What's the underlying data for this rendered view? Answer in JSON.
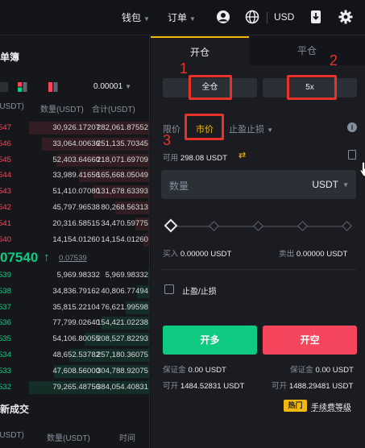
{
  "topnav": {
    "wallet_label": "钱包",
    "orders_label": "订单",
    "currency_label": "USD",
    "icons": [
      "account-icon",
      "globe-icon",
      "download-icon",
      "gear-icon"
    ]
  },
  "orderbook": {
    "title": "单簿",
    "precision": "0.00001",
    "head_price": "(USDT)",
    "head_amount": "数量(USDT)",
    "head_total": "合计(USDT)",
    "asks": [
      {
        "price": "547",
        "amount": "30,926.17207",
        "total": "282,061.87552"
      },
      {
        "price": "546",
        "amount": "33,064.00636",
        "total": "251,135.70345"
      },
      {
        "price": "545",
        "amount": "52,403.64660",
        "total": "218,071.69709"
      },
      {
        "price": "544",
        "amount": "33,989.41656",
        "total": "165,668.05049"
      },
      {
        "price": "543",
        "amount": "51,410.07080",
        "total": "131,678.63393"
      },
      {
        "price": "542",
        "amount": "45,797.96538",
        "total": "80,268.56313"
      },
      {
        "price": "541",
        "amount": "20,316.58515",
        "total": "34,470.59775"
      },
      {
        "price": "540",
        "amount": "14,154.01260",
        "total": "14,154.01260"
      }
    ],
    "mid_price": "07540",
    "mid_arrow": "↑",
    "mark_price": "0.07539",
    "bids": [
      {
        "price": "539",
        "amount": "5,969.98332",
        "total": "5,969.98332"
      },
      {
        "price": "538",
        "amount": "34,836.79162",
        "total": "40,806.77494"
      },
      {
        "price": "537",
        "amount": "35,815.22104",
        "total": "76,621.99598"
      },
      {
        "price": "536",
        "amount": "77,799.02640",
        "total": "154,421.02238"
      },
      {
        "price": "535",
        "amount": "54,106.80055",
        "total": "208,527.82293"
      },
      {
        "price": "534",
        "amount": "48,652.53782",
        "total": "257,180.36075"
      },
      {
        "price": "533",
        "amount": "47,608.56000",
        "total": "304,788.92075"
      },
      {
        "price": "532",
        "amount": "79,265.48756",
        "total": "384,054.40831"
      }
    ],
    "trades_title": "新成交",
    "trades_head_price": "(USDT)",
    "trades_head_amount": "数量(USDT)",
    "trades_head_time": "时间"
  },
  "trade_panel": {
    "tab_open": "开仓",
    "tab_close": "平仓",
    "margin_mode": "全仓",
    "leverage": "5x",
    "order_type_limit": "限价",
    "order_type_market": "市价",
    "order_type_stop": "止盈止损",
    "available_label": "可用",
    "available_value": "298.08 USDT",
    "qty_placeholder": "数量",
    "qty_unit": "USDT",
    "buy_label": "买入",
    "buy_value": "0.00000 USDT",
    "sell_label": "卖出",
    "sell_value": "0.00000 USDT",
    "tpsl_label": "止盈/止损",
    "long_button": "开多",
    "short_button": "开空",
    "margin_label_left": "保证金",
    "margin_value_left": "0.00 USDT",
    "margin_label_right": "保证金",
    "margin_value_right": "0.00 USDT",
    "can_open_label_left": "可开",
    "can_open_value_left": "1484.52831 USDT",
    "can_open_label_right": "可开",
    "can_open_value_right": "1488.29481 USDT",
    "hot_badge": "热门",
    "fee_link": "手续费等级"
  },
  "annotations": {
    "callout_1": "1",
    "callout_2": "2",
    "callout_3": "3",
    "highlight_color": "#e8332a"
  },
  "colors": {
    "accent": "#f0b90b",
    "buy": "#0ecb81",
    "sell": "#f6465d",
    "background": "#131418"
  }
}
